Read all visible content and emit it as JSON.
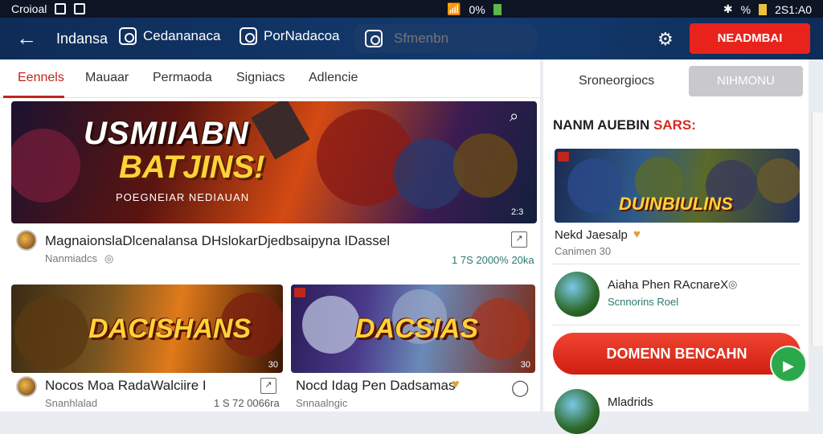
{
  "status_bar": {
    "carrier": "Croioal",
    "battery": "0%",
    "signal_right": "%",
    "time": "2S1:A0"
  },
  "app_bar": {
    "back_icon": "arrow-left-icon",
    "title": "Indansa",
    "nav": [
      {
        "label": "Cedananaca",
        "icon": "instagram-icon"
      },
      {
        "label": "PorNadacoa",
        "icon": "chat-icon"
      }
    ],
    "search_placeholder": "Sfmenbn",
    "settings_icon": "gear-icon",
    "cta_label": "NEADMBAI",
    "accent_color": "#e8231c"
  },
  "tabs": [
    {
      "label": "Eennels",
      "active": true
    },
    {
      "label": "Mauaar",
      "active": false
    },
    {
      "label": "Permaoda",
      "active": false
    },
    {
      "label": "Signiacs",
      "active": false
    },
    {
      "label": "Adlencie",
      "active": false
    }
  ],
  "hero": {
    "title_line1": "USMIIABN",
    "title_line2": "BATJINS!",
    "subtitle": "POEGNEIAR NEDIAUAN",
    "corner_num": "2:3",
    "meta_title": "MagnaionslaDlcenalansa DHslokarDjedbsaipyna IDassel",
    "meta_sub": "Nanmiadcs",
    "meta_stat": "1 7S 2000% 20ka"
  },
  "cards": [
    {
      "thumb_title": "DACISHANS",
      "thumb_num": "30",
      "title": "Nocos Moa RadaWalciire I",
      "sub": "Snanhlalad",
      "stat": "1 S 72 0066ra"
    },
    {
      "thumb_title": "DACSIAS",
      "thumb_num": "30",
      "title": "Nocd Idag Pen Dadsamas",
      "sub": "Snnaalngic"
    }
  ],
  "right_panel": {
    "tab_label": "Sroneorgiocs",
    "button_label": "NIHMONU",
    "section_title": "NANM AUEBIN",
    "section_accent": "SARS:",
    "feature": {
      "thumb_title": "DUINBIULINS",
      "title": "Nekd Jaesalp",
      "sub": "Canimen 30"
    },
    "list_item": {
      "title": "Aiaha Phen RAcnareX",
      "sub": "Scnnorins Roel"
    },
    "play_button": "DOMENN BENCAHN",
    "last_item": "Mladrids"
  }
}
